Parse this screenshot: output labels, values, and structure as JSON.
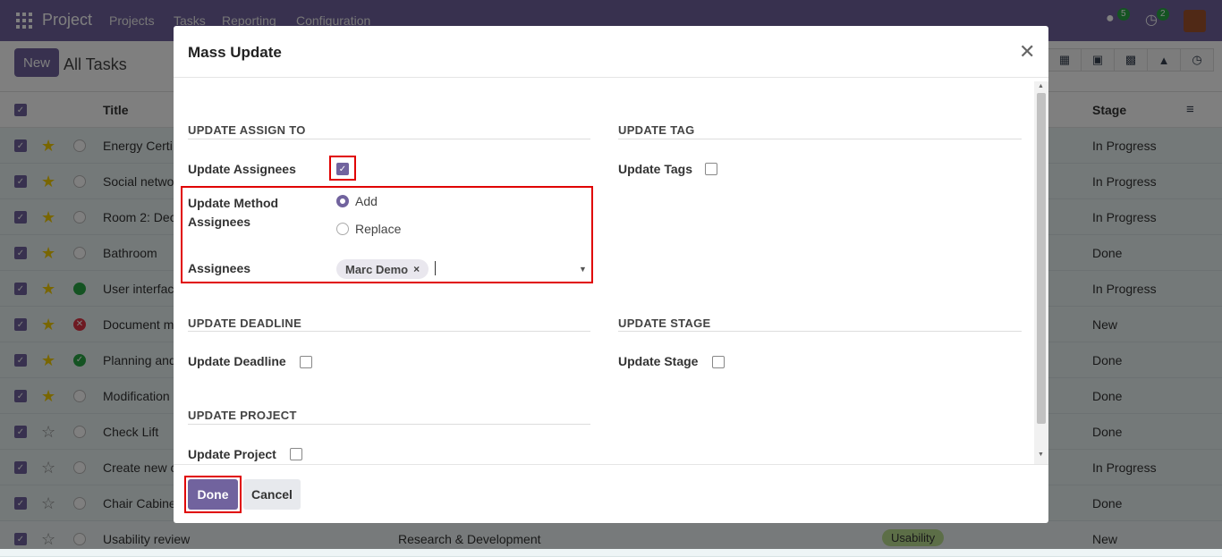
{
  "topbar": {
    "app": "Project",
    "menus": [
      "Projects",
      "Tasks",
      "Reporting",
      "Configuration"
    ],
    "chat_count": "5",
    "activity_count": "2"
  },
  "control": {
    "new_label": "New",
    "breadcrumb": "All Tasks"
  },
  "table": {
    "col_title": "Title",
    "col_stage": "Stage",
    "rows": [
      {
        "title": "Energy Certi",
        "stage": "In Progress",
        "starred": true,
        "status": "none"
      },
      {
        "title": "Social netwo",
        "stage": "In Progress",
        "starred": true,
        "status": "none"
      },
      {
        "title": "Room 2: Dec",
        "stage": "In Progress",
        "starred": true,
        "status": "none"
      },
      {
        "title": "Bathroom",
        "stage": "Done",
        "starred": true,
        "status": "none"
      },
      {
        "title": "User interfac",
        "stage": "In Progress",
        "starred": true,
        "status": "green"
      },
      {
        "title": "Document m",
        "stage": "New",
        "starred": true,
        "status": "blocked"
      },
      {
        "title": "Planning and",
        "stage": "Done",
        "starred": true,
        "status": "done"
      },
      {
        "title": "Modification",
        "stage": "Done",
        "starred": true,
        "status": "none"
      },
      {
        "title": "Check Lift",
        "stage": "Done",
        "starred": false,
        "status": "none"
      },
      {
        "title": "Create new c",
        "stage": "In Progress",
        "starred": false,
        "status": "none"
      },
      {
        "title": "Chair Cabine",
        "stage": "Done",
        "starred": false,
        "status": "none"
      },
      {
        "title": "Usability review",
        "stage": "New",
        "starred": false,
        "status": "none",
        "project": "Research & Development",
        "tag": "Usability"
      }
    ]
  },
  "modal": {
    "title": "Mass Update",
    "sec_assign": "UPDATE ASSIGN TO",
    "sec_tag": "UPDATE TAG",
    "update_assignees": "Update Assignees",
    "update_tags": "Update Tags",
    "method_label": "Update Method Assignees",
    "opt_add": "Add",
    "opt_replace": "Replace",
    "assignees_label": "Assignees",
    "assignee_tag": "Marc Demo",
    "sec_deadline": "UPDATE DEADLINE",
    "sec_stage": "UPDATE STAGE",
    "update_deadline": "Update Deadline",
    "update_stage": "Update Stage",
    "sec_project": "UPDATE PROJECT",
    "update_project": "Update Project",
    "done_label": "Done",
    "cancel_label": "Cancel"
  }
}
